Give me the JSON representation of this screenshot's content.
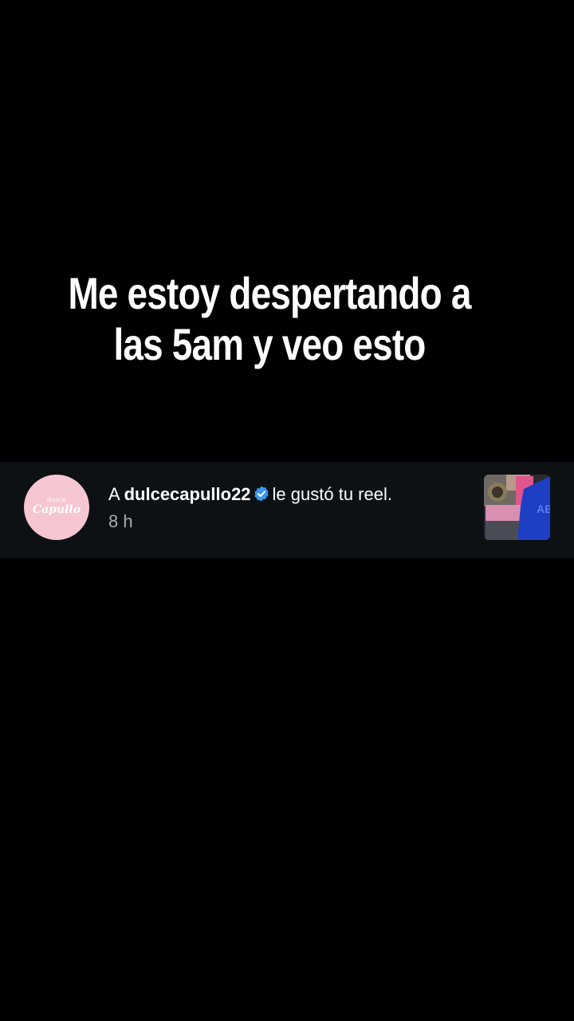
{
  "caption": {
    "line1": "Me estoy despertando a",
    "line2": "las 5am y veo esto"
  },
  "notification": {
    "prefix": "A",
    "username": "dulcecapullo22",
    "action": "le gustó tu reel.",
    "time": "8 h",
    "avatar": {
      "small_text": "dulce",
      "brand_text": "Capullo",
      "bg_color": "#f6c6d2"
    },
    "verified_icon": "verified-badge-icon",
    "verified_color": "#3897f0",
    "thumbnail": "reel-thumbnail"
  }
}
